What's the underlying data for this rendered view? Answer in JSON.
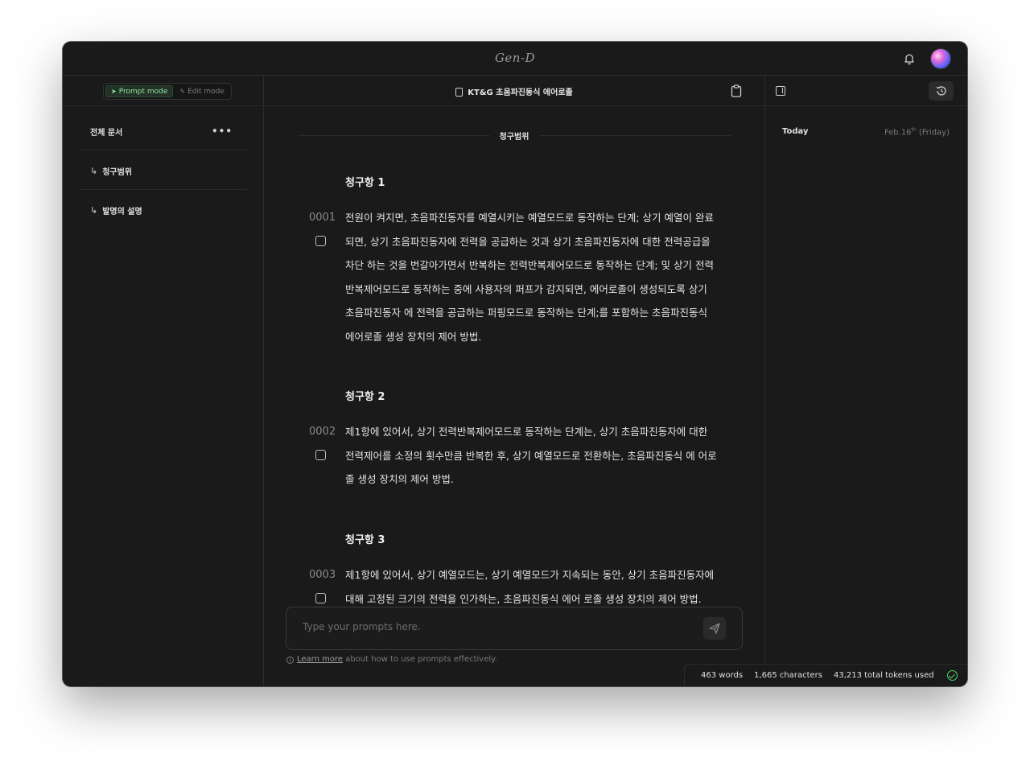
{
  "app": {
    "logo": "Gen-D"
  },
  "left": {
    "modes": {
      "prompt": "Prompt mode",
      "edit": "Edit mode"
    },
    "doc_head": "전체 문서",
    "items": [
      {
        "label": "청구범위"
      },
      {
        "label": "발명의 설명"
      }
    ]
  },
  "center": {
    "doc_title": "KT&G 초음파진동식 에어로졸",
    "section_title": "청구범위",
    "claims": [
      {
        "title": "청구항 1",
        "num": "0001",
        "text": "전원이 켜지면, 초음파진동자를 예열시키는 예열모드로 동작하는 단계; 상기 예열이 완료되면, 상기 초음파진동자에 전력을 공급하는 것과 상기 초음파진동자에 대한 전력공급을 차단 하는 것을 번갈아가면서 반복하는 전력반복제어모드로 동작하는 단계; 및 상기 전력반복제어모드로 동작하는 중에 사용자의 퍼프가 감지되면, 에어로졸이 생성되도록 상기 초음파진동자 에 전력을 공급하는 퍼핑모드로 동작하는 단계;를 포함하는 초음파진동식 에어로졸 생성 장치의 제어 방법."
      },
      {
        "title": "청구항 2",
        "num": "0002",
        "text": "제1항에 있어서, 상기 전력반복제어모드로 동작하는 단계는, 상기 초음파진동자에 대한 전력제어를 소정의 횟수만큼 반복한 후, 상기 예열모드로 전환하는, 초음파진동식 에 어로졸 생성 장치의 제어 방법."
      },
      {
        "title": "청구항 3",
        "num": "0003",
        "text": "제1항에 있어서, 상기 예열모드는, 상기 예열모드가 지속되는 동안, 상기 초음파진동자에 대해 고정된 크기의 전력을 인가하는, 초음파진동식 에어 로졸 생성 장치의 제어 방법."
      }
    ],
    "prompt": {
      "placeholder": "Type your prompts here."
    },
    "hint": {
      "link": "Learn more",
      "rest": " about how to use prompts effectively."
    }
  },
  "right": {
    "today": "Today",
    "date_main": "Feb.16",
    "date_sup": "th",
    "date_day": " (Friday)"
  },
  "status": {
    "words": "463 words",
    "characters": "1,665 characters",
    "tokens": "43,213 total tokens used"
  }
}
